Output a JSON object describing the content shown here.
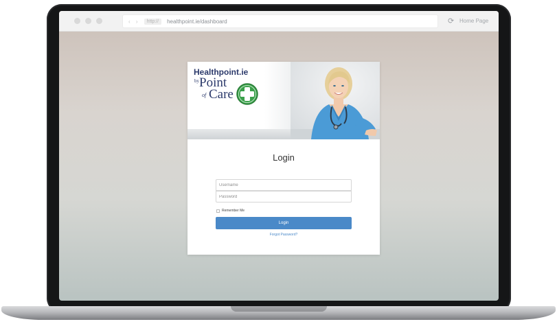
{
  "browser": {
    "nav_arrows": "‹ ›",
    "scheme": "http://",
    "url": "healthpoint.ie/dashboard",
    "reload_icon": "reload-icon",
    "home_label": "Home Page"
  },
  "brand": {
    "title": "Healthpoint.ie",
    "by": "by",
    "point": "Point",
    "of": "of",
    "care": "Care",
    "logo_color": "#3aa04a"
  },
  "login": {
    "title": "Login",
    "username_placeholder": "Username",
    "password_placeholder": "Password",
    "remember_label": "Remember Me",
    "button_label": "Login",
    "forgot_label": "Forgot Password?",
    "accent": "#4a89c8"
  }
}
